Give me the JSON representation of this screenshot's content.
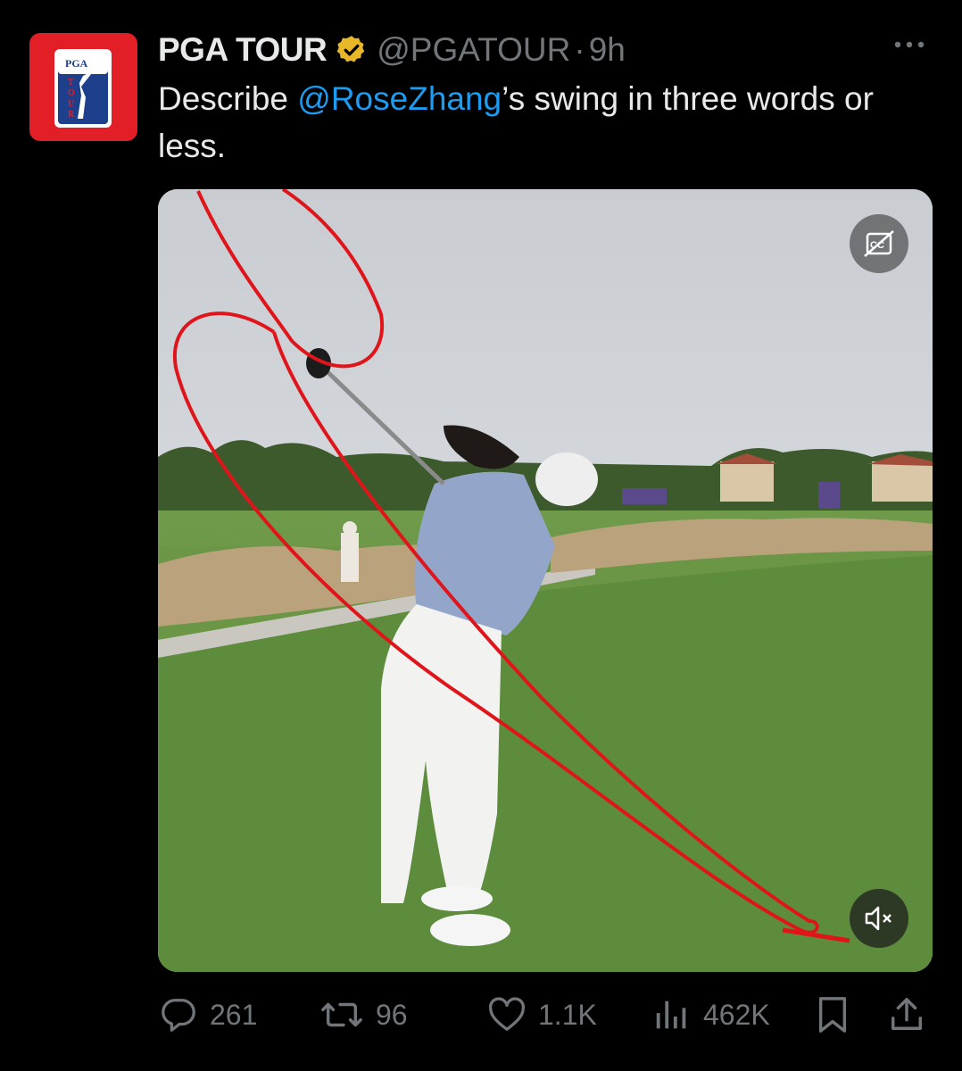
{
  "tweet": {
    "author_name": "PGA TOUR",
    "handle": "@PGATOUR",
    "separator": "·",
    "time": "9h",
    "text_before": "Describe ",
    "mention": "@RoseZhang",
    "text_after": "’s swing in three words or less."
  },
  "avatar": {
    "logo_text_top": "PGA",
    "logo_text_side": "TOUR",
    "brand_color": "#e21e26"
  },
  "media": {
    "cc_icon": "closed-captions-off-icon",
    "mute_icon": "volume-muted-icon",
    "annotation_color": "#e0151b"
  },
  "actions": {
    "replies": "261",
    "reposts": "96",
    "likes": "1.1K",
    "views": "462K"
  },
  "colors": {
    "accent": "#1d9bf0",
    "muted": "#71767b",
    "verified": "#e8b829"
  }
}
